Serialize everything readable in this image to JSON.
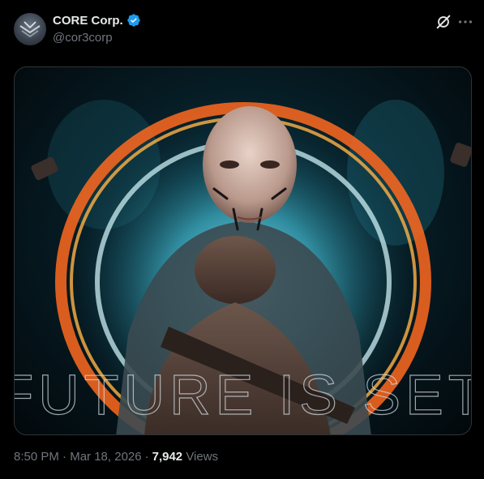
{
  "tweet": {
    "author": {
      "display_name": "CORE Corp.",
      "handle": "@cor3corp",
      "verified": true,
      "verified_badge_color": "#1d9bf0"
    },
    "actions": {
      "grok_icon": "grok-icon",
      "more_icon": "more-icon"
    },
    "media": {
      "overlay_text": "FUTURE IS SET",
      "palette": {
        "portal_fire": "#ff6a1f",
        "portal_energy": "#4fd8f0",
        "background": "#061a22"
      }
    },
    "meta": {
      "time": "8:50 PM",
      "separator": "·",
      "date": "Mar 18, 2026",
      "views_count": "7,942",
      "views_label": "Views"
    }
  }
}
